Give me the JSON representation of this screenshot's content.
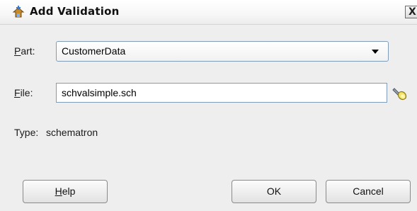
{
  "window": {
    "title": "Add Validation",
    "close_glyph": "X"
  },
  "form": {
    "part_label_key": "P",
    "part_label_rest": "art:",
    "part_value": "CustomerData",
    "file_label_key": "F",
    "file_label_rest": "ile:",
    "file_value": "schvalsimple.sch",
    "type_label": "Type:",
    "type_value": "schematron"
  },
  "buttons": {
    "help_key": "H",
    "help_rest": "elp",
    "ok": "OK",
    "cancel": "Cancel"
  },
  "icons": {
    "title": "add-validation-icon",
    "browse": "flashlight-search-icon",
    "dropdown": "chevron-down-icon"
  }
}
